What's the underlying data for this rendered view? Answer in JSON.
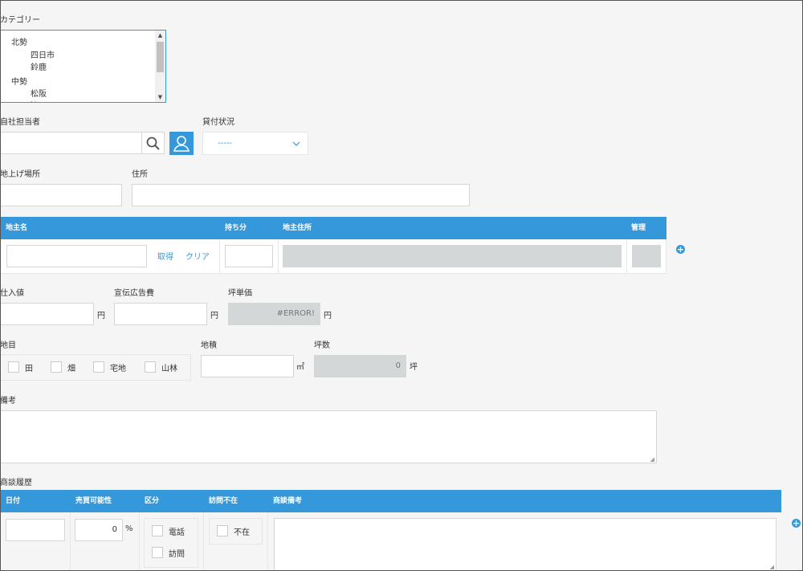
{
  "category": {
    "label": "カテゴリー",
    "options": [
      {
        "text": "北勢",
        "level": 0
      },
      {
        "text": "四日市",
        "level": 1
      },
      {
        "text": "鈴鹿",
        "level": 1
      },
      {
        "text": "中勢",
        "level": 0
      },
      {
        "text": "松阪",
        "level": 1
      },
      {
        "text": "津",
        "level": 1
      }
    ],
    "scroll_up": "▲",
    "scroll_down": "▼"
  },
  "staff": {
    "label": "自社担当者",
    "value": ""
  },
  "rental": {
    "label": "貸付状況",
    "value": "-----"
  },
  "site": {
    "label": "地上げ場所",
    "value": ""
  },
  "address": {
    "label": "住所",
    "value": ""
  },
  "owner_table": {
    "headers": {
      "name": "地主名",
      "share": "持ち分",
      "owner_address": "地主住所",
      "manage": "管理"
    },
    "get_link": "取得",
    "clear_link": "クリア",
    "add": "+"
  },
  "purchase": {
    "label": "仕入値",
    "unit": "円",
    "value": ""
  },
  "ad_cost": {
    "label": "宣伝広告費",
    "unit": "円",
    "value": ""
  },
  "tsubo_price": {
    "label": "坪単価",
    "value": "#ERROR!",
    "unit": "円"
  },
  "land_type": {
    "label": "地目",
    "options": [
      {
        "text": "田",
        "checked": false
      },
      {
        "text": "畑",
        "checked": false
      },
      {
        "text": "宅地",
        "checked": false
      },
      {
        "text": "山林",
        "checked": false
      }
    ]
  },
  "area": {
    "label": "地積",
    "unit": "㎡",
    "value": ""
  },
  "tsubo_count": {
    "label": "坪数",
    "value": "0",
    "unit": "坪"
  },
  "remarks": {
    "label": "備考",
    "value": ""
  },
  "history": {
    "label": "商談履歴",
    "headers": {
      "date": "日付",
      "possibility": "売買可能性",
      "type": "区分",
      "absent": "訪問不在",
      "memo": "商談備考"
    },
    "possibility_value": "0",
    "possibility_unit": "%",
    "type_options": [
      "電話",
      "訪問"
    ],
    "absent_option": "不在",
    "add": "+"
  },
  "colors": {
    "accent": "#3498db",
    "background": "#f5f5f5",
    "disabled": "#d4d7d7"
  }
}
